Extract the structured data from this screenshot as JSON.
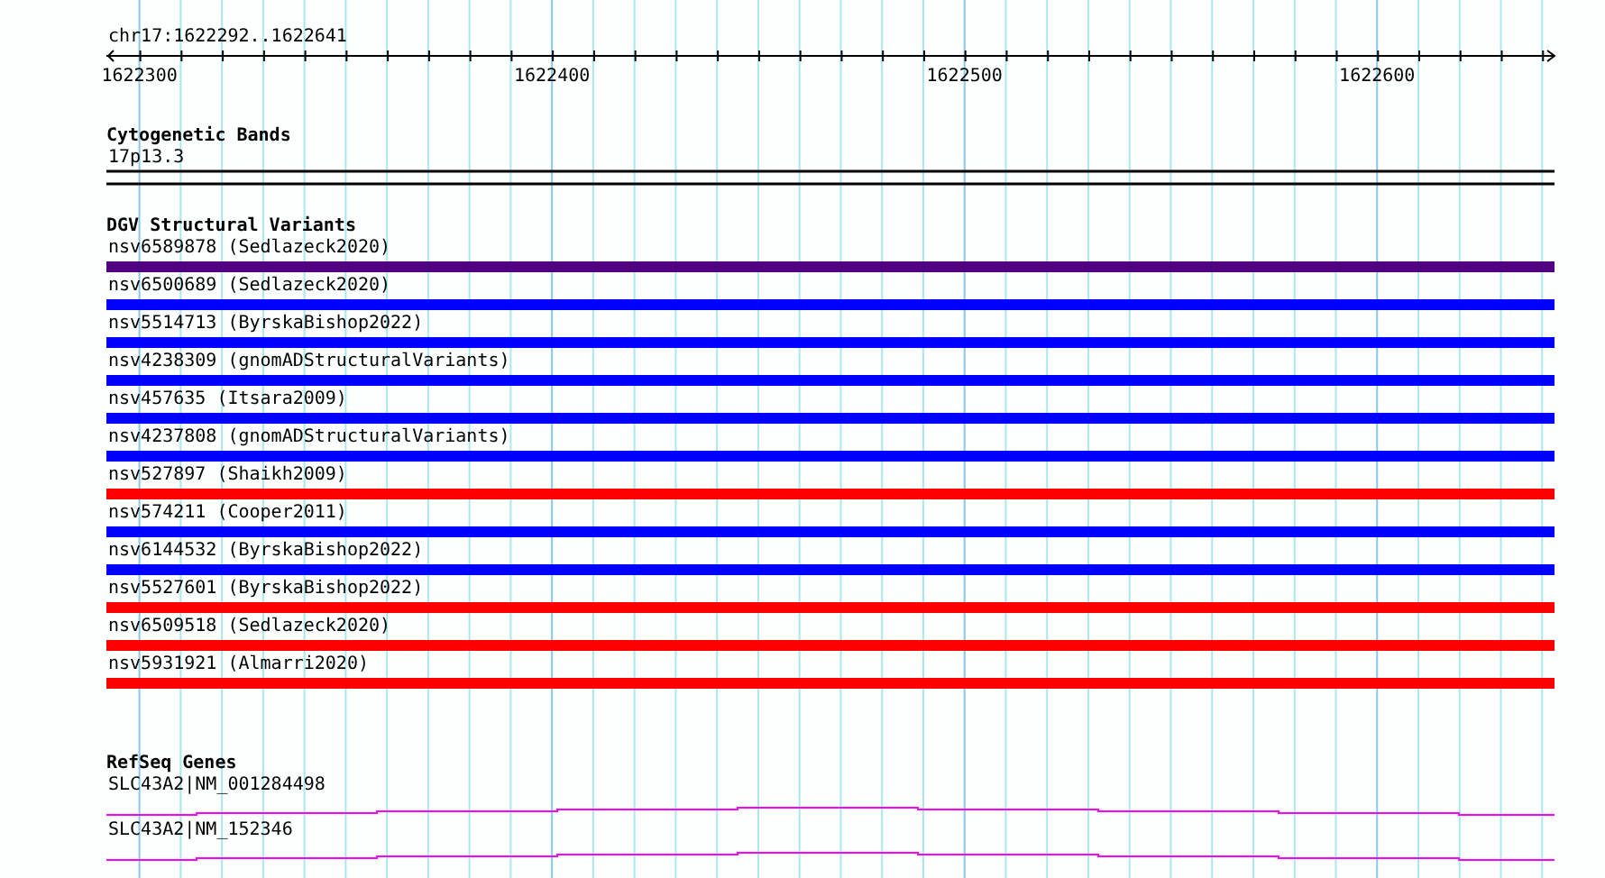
{
  "ruler": {
    "location": "chr17:1622292..1622641",
    "ticks": [
      "1622300",
      "1622400",
      "1622500",
      "1622600"
    ]
  },
  "cytogenetic_bands": {
    "title": "Cytogenetic Bands",
    "band": "17p13.3"
  },
  "dgv": {
    "title": "DGV Structural Variants",
    "variants": [
      {
        "label": "nsv6589878 (Sedlazeck2020)",
        "color": "#500080"
      },
      {
        "label": "nsv6500689 (Sedlazeck2020)",
        "color": "#0000ff"
      },
      {
        "label": "nsv5514713 (ByrskaBishop2022)",
        "color": "#0000ff"
      },
      {
        "label": "nsv4238309 (gnomADStructuralVariants)",
        "color": "#0000ff"
      },
      {
        "label": "nsv457635 (Itsara2009)",
        "color": "#0000ff"
      },
      {
        "label": "nsv4237808 (gnomADStructuralVariants)",
        "color": "#0000ff"
      },
      {
        "label": "nsv527897 (Shaikh2009)",
        "color": "#ff0000"
      },
      {
        "label": "nsv574211 (Cooper2011)",
        "color": "#0000ff"
      },
      {
        "label": "nsv6144532 (ByrskaBishop2022)",
        "color": "#0000ff"
      },
      {
        "label": "nsv5527601 (ByrskaBishop2022)",
        "color": "#ff0000"
      },
      {
        "label": "nsv6509518 (Sedlazeck2020)",
        "color": "#ff0000"
      },
      {
        "label": "nsv5931921 (Almarri2020)",
        "color": "#ff0000"
      }
    ]
  },
  "refseq": {
    "title": "RefSeq Genes",
    "genes": [
      {
        "label": "SLC43A2|NM_001284498"
      },
      {
        "label": "SLC43A2|NM_152346"
      }
    ]
  }
}
